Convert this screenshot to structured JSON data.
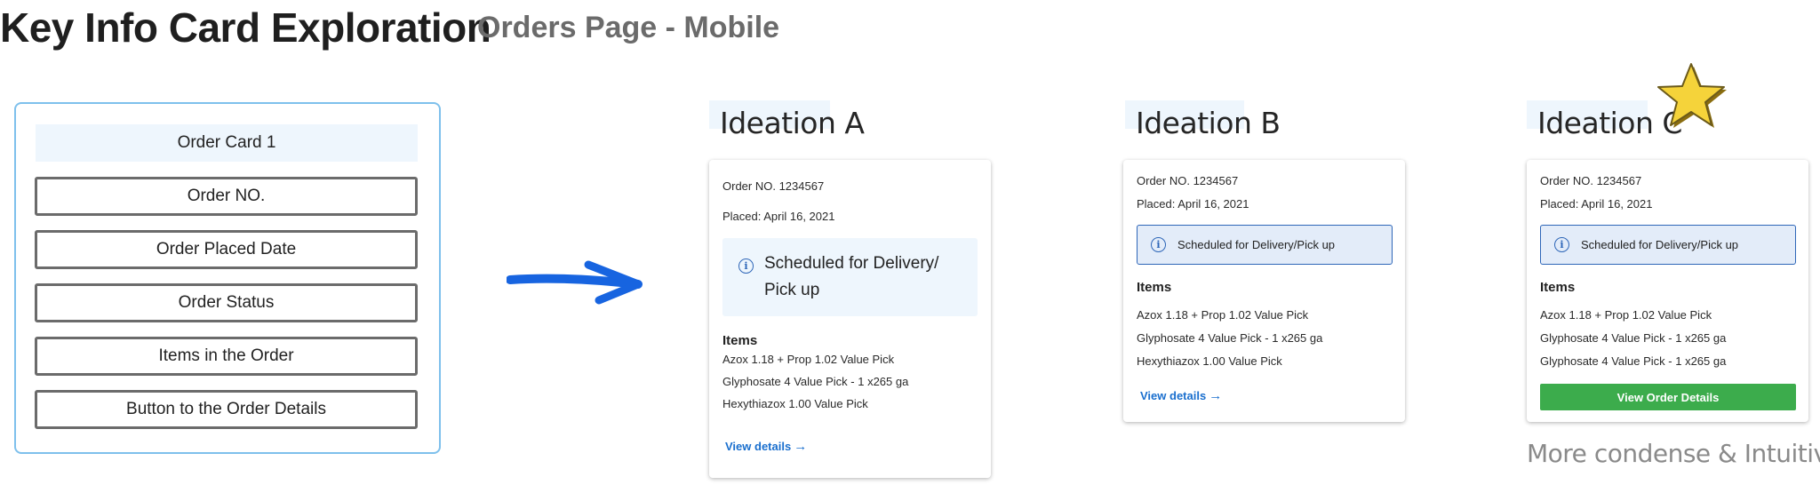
{
  "header": {
    "title": "Key Info Card Exploration",
    "subtitle": "Orders Page - Mobile"
  },
  "outline": {
    "heading": "Order Card 1",
    "rows": [
      "Order NO.",
      "Order Placed Date",
      "Order Status",
      "Items in the Order",
      "Button to the Order Details"
    ]
  },
  "card_common": {
    "order_no": "Order NO.  1234567",
    "placed": "Placed: April 16, 2021",
    "items_heading": "Items",
    "items": [
      "Azox 1.18 + Prop 1.02 Value Pick",
      "Glyphosate 4 Value Pick - 1 x265 ga",
      "Hexythiazox 1.00 Value Pick"
    ],
    "items_c": [
      "Azox 1.18 + Prop 1.02 Value Pick",
      "Glyphosate 4 Value Pick - 1 x265 ga",
      "Glyphosate 4 Value Pick - 1 x265 ga"
    ],
    "status_small": "Scheduled for Delivery/Pick up",
    "status_big_line1": "Scheduled for Delivery/",
    "status_big_line2": "Pick up",
    "view_details": "View details",
    "view_order_details": "View Order Details",
    "info_glyph": "i",
    "arrow_glyph": "→"
  },
  "ideations": {
    "a": "Ideation A",
    "b": "Ideation B",
    "c": "Ideation C"
  },
  "footnote": "More condense & Intuitive",
  "colors": {
    "accent_blue": "#1a6fce",
    "status_border": "#2e66b8",
    "highlight": "#eef6fd",
    "green_button": "#3cac4c",
    "star": "#f5d33a"
  },
  "icons": [
    "info-icon",
    "arrow-right-icon",
    "star-icon",
    "hand-drawn-arrow-icon"
  ]
}
